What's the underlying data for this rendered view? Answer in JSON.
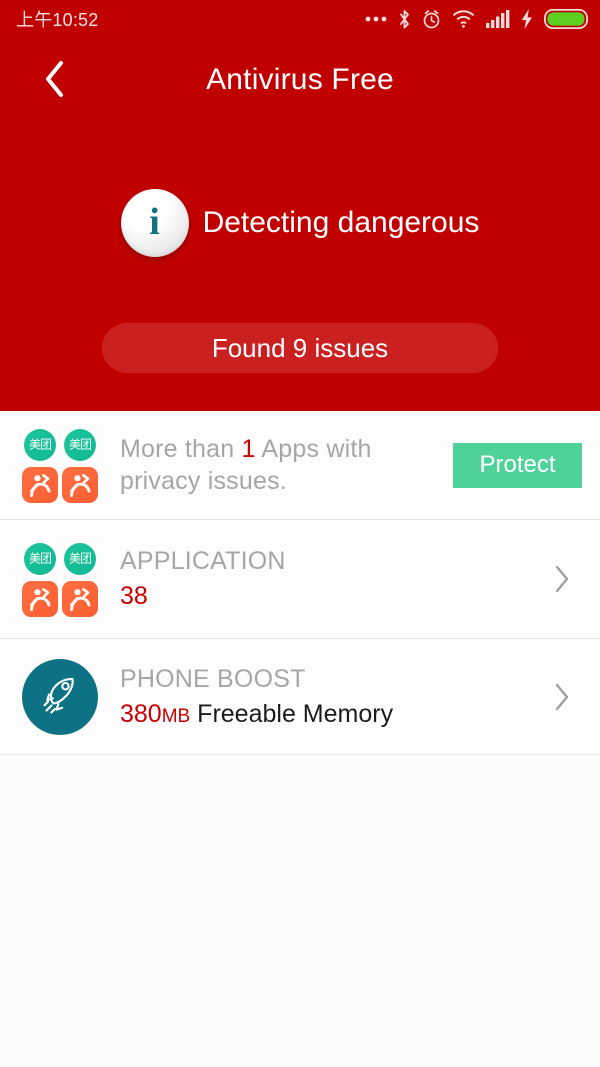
{
  "statusbar": {
    "time": "上午10:52",
    "icons": [
      "more-dots-icon",
      "bluetooth-icon",
      "alarm-icon",
      "wifi-icon",
      "signal-icon",
      "charging-bolt-icon",
      "battery-icon"
    ],
    "battery_color": "#5ed020"
  },
  "header": {
    "title": "Antivirus Free",
    "back_icon": "chevron-left-icon",
    "background_color": "#c00000"
  },
  "hero": {
    "status_text": "Detecting dangerous",
    "status_icon": "info-icon",
    "info_glyph": "i",
    "issues_button_label": "Found 9 issues",
    "issues_button_color": "#cb2020"
  },
  "list": {
    "rows": [
      {
        "name": "privacy",
        "icon_type": "app-cluster",
        "app_icon_label": "美团",
        "primary_prefix": "More than ",
        "primary_highlight": "1",
        "primary_suffix": " Apps with",
        "primary_line2": "privacy issues.",
        "action_label": "Protect",
        "action_color": "#4ed29a"
      },
      {
        "name": "application",
        "icon_type": "app-cluster",
        "app_icon_label": "美团",
        "title": "APPLICATION",
        "value": "38",
        "chevron": "chevron-right-icon"
      },
      {
        "name": "phone-boost",
        "icon_type": "rocket",
        "icon_name": "rocket-icon",
        "icon_bg": "#0d7384",
        "title": "PHONE BOOST",
        "value": "380",
        "unit": "MB",
        "value_suffix": "Freeable Memory",
        "chevron": "chevron-right-icon"
      }
    ]
  }
}
